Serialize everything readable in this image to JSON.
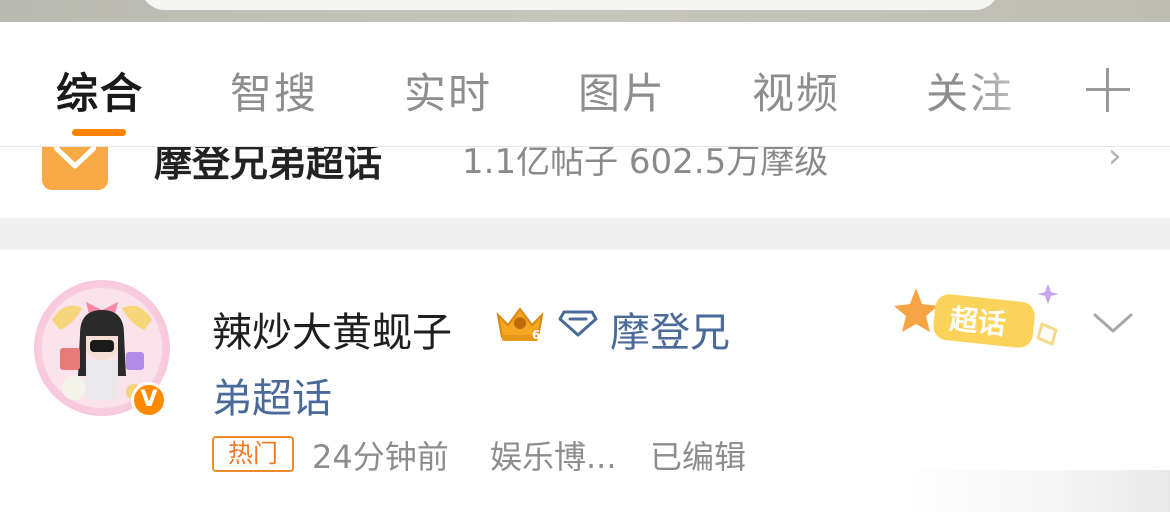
{
  "tabs": [
    {
      "label": "综合",
      "active": true
    },
    {
      "label": "智搜",
      "active": false
    },
    {
      "label": "实时",
      "active": false
    },
    {
      "label": "图片",
      "active": false
    },
    {
      "label": "视频",
      "active": false
    },
    {
      "label": "关注",
      "active": false
    }
  ],
  "add_tab_icon": "plus-icon",
  "topic_row": {
    "name": "摩登兄弟超话",
    "meta": "1.1亿帖子  602.5万摩级",
    "icon": "supertopic-logo-icon"
  },
  "post": {
    "username": "辣炒大黄蚬子",
    "topic_link_line1": "摩登兄",
    "topic_link_line2": "弟超话",
    "badge_text": "超话",
    "tag": "热门",
    "time": "24分钟前",
    "source": "娱乐博...",
    "edited": "已编辑",
    "verified_badge": "V"
  },
  "colors": {
    "accent": "#ff8200",
    "link": "#4a6a9a",
    "tag": "#f0782a"
  }
}
